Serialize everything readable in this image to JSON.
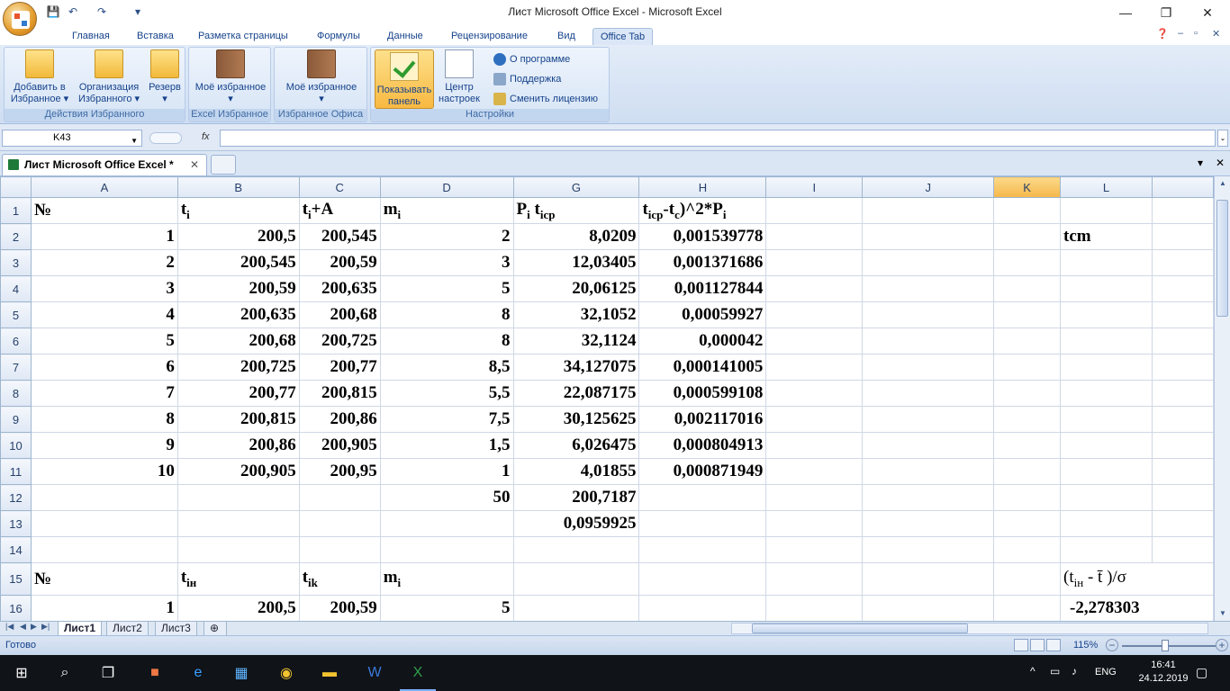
{
  "window": {
    "title": "Лист Microsoft Office Excel - Microsoft Excel",
    "minimize": "—",
    "restore": "❐",
    "close": "✕"
  },
  "ribbon_tabs": [
    "Главная",
    "Вставка",
    "Разметка страницы",
    "Формулы",
    "Данные",
    "Рецензирование",
    "Вид",
    "Office Tab"
  ],
  "ribbon": {
    "group1": {
      "label": "Действия Избранного",
      "add": "Добавить в Избранное",
      "organize": "Организация Избранного",
      "backup": "Резерв"
    },
    "group2": {
      "label": "Excel Избранное",
      "fav": "Моё избранное"
    },
    "group3": {
      "label": "Избранное Офиса",
      "fav": "Моё избранное"
    },
    "group4": {
      "label": "Настройки",
      "show_panel": "Показывать панель",
      "settings_center": "Центр настроек",
      "about": "О программе",
      "support": "Поддержка",
      "license": "Сменить лицензию"
    }
  },
  "formula_bar": {
    "cell": "K43",
    "fx": "fx",
    "value": ""
  },
  "doc_tab": {
    "name": "Лист Microsoft Office Excel *",
    "close": "✕"
  },
  "columns": [
    "A",
    "B",
    "C",
    "D",
    "G",
    "H",
    "I",
    "J",
    "K",
    "L"
  ],
  "selected_column": "K",
  "rows": [
    {
      "n": "1",
      "A": "№",
      "B": "t",
      "Bs": "i",
      "C": "t",
      "Cs": "i",
      "Ct": "+A",
      "D": "m",
      "Ds": "i",
      "G": "P",
      "Gs": "i",
      "Gt": " t",
      "Gs2": "icp",
      "H": "t",
      "Hs": "icp",
      "Ht": "-t",
      "Hs2": "c",
      "Ht2": ")^2*P",
      "Hs3": "i"
    },
    {
      "n": "2",
      "A": "1",
      "B": "200,5",
      "C": "200,545",
      "D": "2",
      "G": "8,0209",
      "H": "0,001539778",
      "L": "tcm"
    },
    {
      "n": "3",
      "A": "2",
      "B": "200,545",
      "C": "200,59",
      "D": "3",
      "G": "12,03405",
      "H": "0,001371686"
    },
    {
      "n": "4",
      "A": "3",
      "B": "200,59",
      "C": "200,635",
      "D": "5",
      "G": "20,06125",
      "H": "0,001127844"
    },
    {
      "n": "5",
      "A": "4",
      "B": "200,635",
      "C": "200,68",
      "D": "8",
      "G": "32,1052",
      "H": "0,00059927"
    },
    {
      "n": "6",
      "A": "5",
      "B": "200,68",
      "C": "200,725",
      "D": "8",
      "G": "32,1124",
      "H": "0,000042"
    },
    {
      "n": "7",
      "A": "6",
      "B": "200,725",
      "C": "200,77",
      "D": "8,5",
      "G": "34,127075",
      "H": "0,000141005"
    },
    {
      "n": "8",
      "A": "7",
      "B": "200,77",
      "C": "200,815",
      "D": "5,5",
      "G": "22,087175",
      "H": "0,000599108"
    },
    {
      "n": "9",
      "A": "8",
      "B": "200,815",
      "C": "200,86",
      "D": "7,5",
      "G": "30,125625",
      "H": "0,002117016"
    },
    {
      "n": "10",
      "A": "9",
      "B": "200,86",
      "C": "200,905",
      "D": "1,5",
      "G": "6,026475",
      "H": "0,000804913"
    },
    {
      "n": "11",
      "A": "10",
      "B": "200,905",
      "C": "200,95",
      "D": "1",
      "G": "4,01855",
      "H": "0,000871949"
    },
    {
      "n": "12",
      "D": "50",
      "G": "200,7187"
    },
    {
      "n": "13",
      "G": "0,0959925"
    },
    {
      "n": "14"
    },
    {
      "n": "15",
      "A": "№",
      "B": "t",
      "Bs": "iн",
      "C": "t",
      "Cs": "ik",
      "D": "m",
      "Ds": "i",
      "L": "(t",
      "Ls": "iн",
      "Lt": " - t̄   )/σ"
    },
    {
      "n": "16",
      "A": "1",
      "B": "200,5",
      "C": "200,59",
      "D": "5",
      "L": "-2,278303"
    }
  ],
  "sheets": [
    "Лист1",
    "Лист2",
    "Лист3"
  ],
  "status": {
    "ready": "Готово",
    "zoom": "115%",
    "zoom_level_percent": 115
  },
  "taskbar": {
    "lang": "ENG",
    "time": "16:41",
    "date": "24.12.2019"
  }
}
